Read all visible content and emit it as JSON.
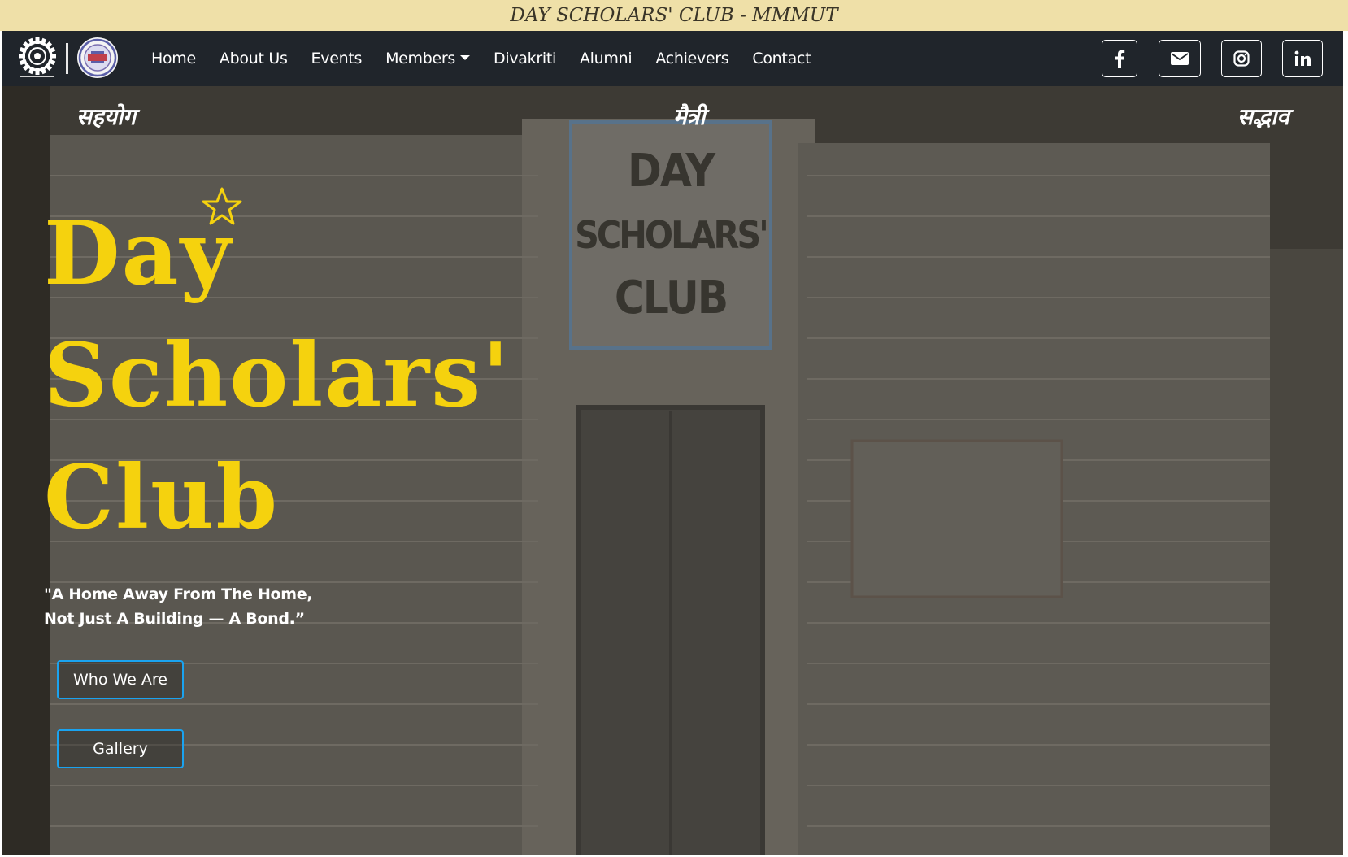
{
  "banner": {
    "title": "DAY SCHOLARS' CLUB - MMMUT"
  },
  "nav": {
    "links": [
      "Home",
      "About Us",
      "Events",
      "Members",
      "Divakriti",
      "Alumni",
      "Achievers",
      "Contact"
    ],
    "members_has_dropdown": true,
    "social_icons": [
      "facebook-icon",
      "mail-icon",
      "instagram-icon",
      "linkedin-icon"
    ]
  },
  "hero": {
    "mottos": [
      "सहयोग",
      "मैत्री",
      "सद्भाव"
    ],
    "title_lines": [
      "Day",
      "Scholars'",
      "Club"
    ],
    "tagline_lines": [
      "\"A Home Away From The Home,",
      "Not Just A Building — A Bond.”"
    ],
    "background_sign": [
      "DAY",
      "SCHOLARS'",
      "CLUB"
    ],
    "buttons": {
      "who_we_are": "Who We Are",
      "gallery": "Gallery"
    }
  },
  "colors": {
    "banner_bg": "#efe0a8",
    "navbar_bg": "#20252b",
    "title_yellow": "#f5d20e",
    "button_border": "#1aa3f0"
  }
}
